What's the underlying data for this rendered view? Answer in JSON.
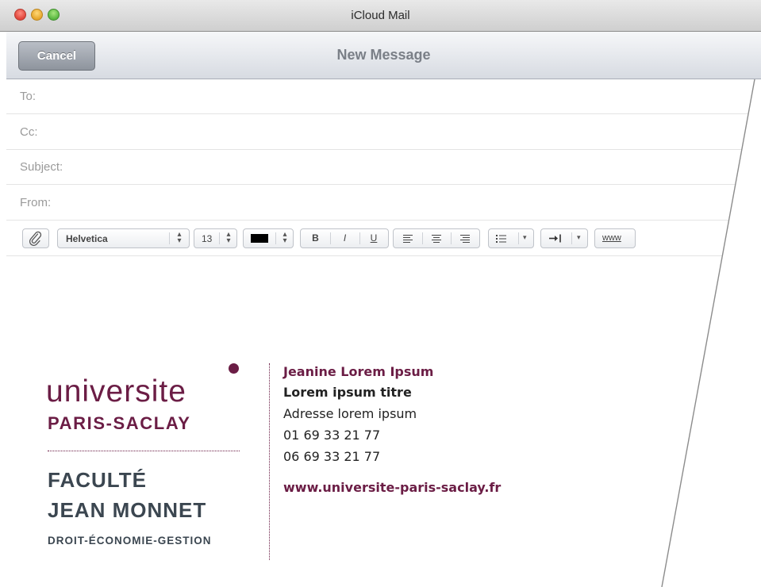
{
  "window": {
    "title": "iCloud Mail"
  },
  "compose": {
    "cancel_label": "Cancel",
    "title": "New Message"
  },
  "fields": {
    "to": "To:",
    "cc": "Cc:",
    "subject": "Subject:",
    "from": "From:"
  },
  "toolbar": {
    "font": "Helvetica",
    "size": "13",
    "color": "#000000",
    "bold": "B",
    "italic": "I",
    "underline": "U",
    "link": "www"
  },
  "signature": {
    "logo_main": "universite",
    "logo_sub": "PARIS-SACLAY",
    "faculty_line1": "FACULTÉ",
    "faculty_line2": "JEAN MONNET",
    "faculty_line3": "DROIT-ÉCONOMIE-GESTION",
    "name": "Jeanine Lorem Ipsum",
    "job_title": "Lorem ipsum titre",
    "address": "Adresse lorem ipsum",
    "phone1": "01 69 33 21 77",
    "phone2": "06 69 33 21 77",
    "website": "www.universite-paris-saclay.fr"
  },
  "colors": {
    "brand": "#6b1d45",
    "faculty": "#3b4650"
  }
}
